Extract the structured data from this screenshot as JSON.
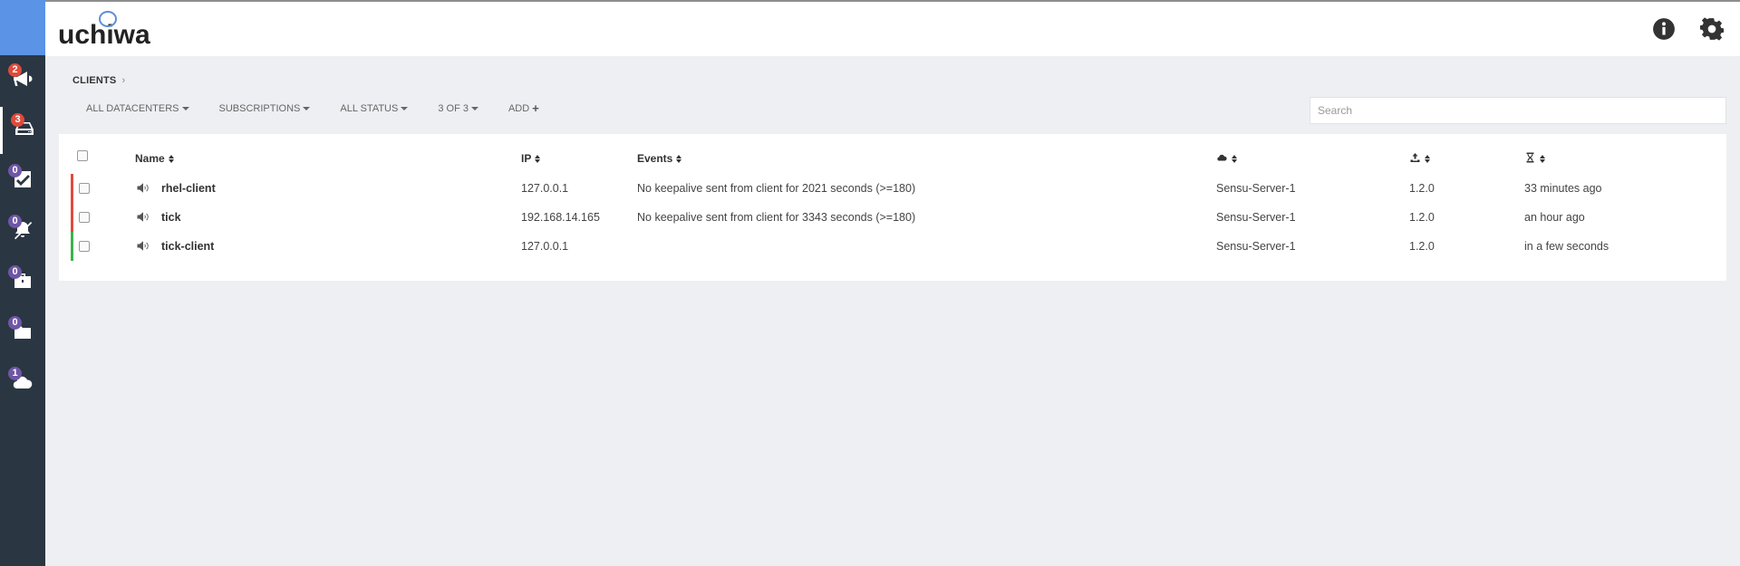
{
  "app": {
    "logo_text": "uchiwa"
  },
  "sidebar": {
    "items": [
      {
        "icon": "bullhorn-icon",
        "badge": "2",
        "badge_color": "#e04b3c"
      },
      {
        "icon": "server-icon",
        "badge": "3",
        "badge_color": "#e04b3c"
      },
      {
        "icon": "check-icon",
        "badge": "0",
        "badge_color": "#6f56a6"
      },
      {
        "icon": "silenced-icon",
        "badge": "0",
        "badge_color": "#6f56a6"
      },
      {
        "icon": "briefcase-icon",
        "badge": "0",
        "badge_color": "#6f56a6"
      },
      {
        "icon": "folder-icon",
        "badge": "0",
        "badge_color": "#6f56a6"
      },
      {
        "icon": "cloud-icon",
        "badge": "1",
        "badge_color": "#6f56a6"
      }
    ]
  },
  "breadcrumb": {
    "label": "CLIENTS",
    "separator": "›"
  },
  "filters": {
    "datacenters": "ALL DATACENTERS",
    "subscriptions": "SUBSCRIPTIONS",
    "status": "ALL STATUS",
    "pagination": "3 OF 3",
    "add": "ADD"
  },
  "search": {
    "placeholder": "Search",
    "value": ""
  },
  "table": {
    "headers": {
      "name": "Name",
      "ip": "IP",
      "events": "Events"
    },
    "rows": [
      {
        "name": "rhel-client",
        "ip": "127.0.0.1",
        "event": "No keepalive sent from client for 2021 seconds (>=180)",
        "datacenter": "Sensu-Server-1",
        "version": "1.2.0",
        "last_seen": "33 minutes ago",
        "status_color": "#e04b3c"
      },
      {
        "name": "tick",
        "ip": "192.168.14.165",
        "event": "No keepalive sent from client for 3343 seconds (>=180)",
        "datacenter": "Sensu-Server-1",
        "version": "1.2.0",
        "last_seen": "an hour ago",
        "status_color": "#e04b3c"
      },
      {
        "name": "tick-client",
        "ip": "127.0.0.1",
        "event": "",
        "datacenter": "Sensu-Server-1",
        "version": "1.2.0",
        "last_seen": "in a few seconds",
        "status_color": "#3cb44b"
      }
    ]
  }
}
